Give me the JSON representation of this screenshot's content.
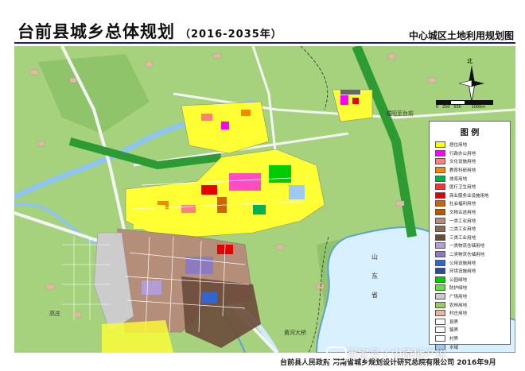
{
  "header": {
    "title": "台前县城乡总体规划",
    "years": "（2016-2035年）",
    "subtitle": "中心城区土地利用规划图"
  },
  "map_labels": {
    "province": "山\n东\n省",
    "dam": "黄河大桥",
    "north": "北",
    "scale": "0   250   500        1000m",
    "road_east": "濮阳至台前",
    "village": "高庄"
  },
  "legend": {
    "title": "图 例",
    "items": [
      {
        "label": "居住用地",
        "color": "#ffff00"
      },
      {
        "label": "行政办公用地",
        "color": "#ff00ff"
      },
      {
        "label": "文化设施用地",
        "color": "#ff7f7f"
      },
      {
        "label": "教育科研用地",
        "color": "#f28a00"
      },
      {
        "label": "体育用地",
        "color": "#00b050"
      },
      {
        "label": "医疗卫生用地",
        "color": "#ff3333"
      },
      {
        "label": "商业服务业设施用地",
        "color": "#e60000"
      },
      {
        "label": "社会福利用地",
        "color": "#cc6600"
      },
      {
        "label": "文物古迹用地",
        "color": "#b35900"
      },
      {
        "label": "一类工业用地",
        "color": "#b48e78"
      },
      {
        "label": "二类工业用地",
        "color": "#8b6a58"
      },
      {
        "label": "三类工业用地",
        "color": "#6b4a3a"
      },
      {
        "label": "一类物流仓储用地",
        "color": "#b29ed6"
      },
      {
        "label": "二类物流仓储用地",
        "color": "#8e7ac0"
      },
      {
        "label": "公用设施用地",
        "color": "#3366cc"
      },
      {
        "label": "环境设施用地",
        "color": "#2a4d99"
      },
      {
        "label": "公园绿地",
        "color": "#00cc00"
      },
      {
        "label": "防护绿地",
        "color": "#66dd44"
      },
      {
        "label": "广场用地",
        "color": "#cccccc"
      },
      {
        "label": "农林用地",
        "color": "#99cc66"
      },
      {
        "label": "村庄用地",
        "color": "#e6b8a2"
      },
      {
        "label": "县界",
        "color": "#ffffff"
      },
      {
        "label": "镇界",
        "color": "#ffffff"
      },
      {
        "label": "村界",
        "color": "#ffffff"
      },
      {
        "label": "水域",
        "color": "#9ec9f0"
      }
    ]
  },
  "footer": {
    "text": "台前县人民政府  河南省城乡规划设计研究总院有限公司  2016年9月"
  },
  "watermark": {
    "text": "百家号 / 中原地产说"
  }
}
